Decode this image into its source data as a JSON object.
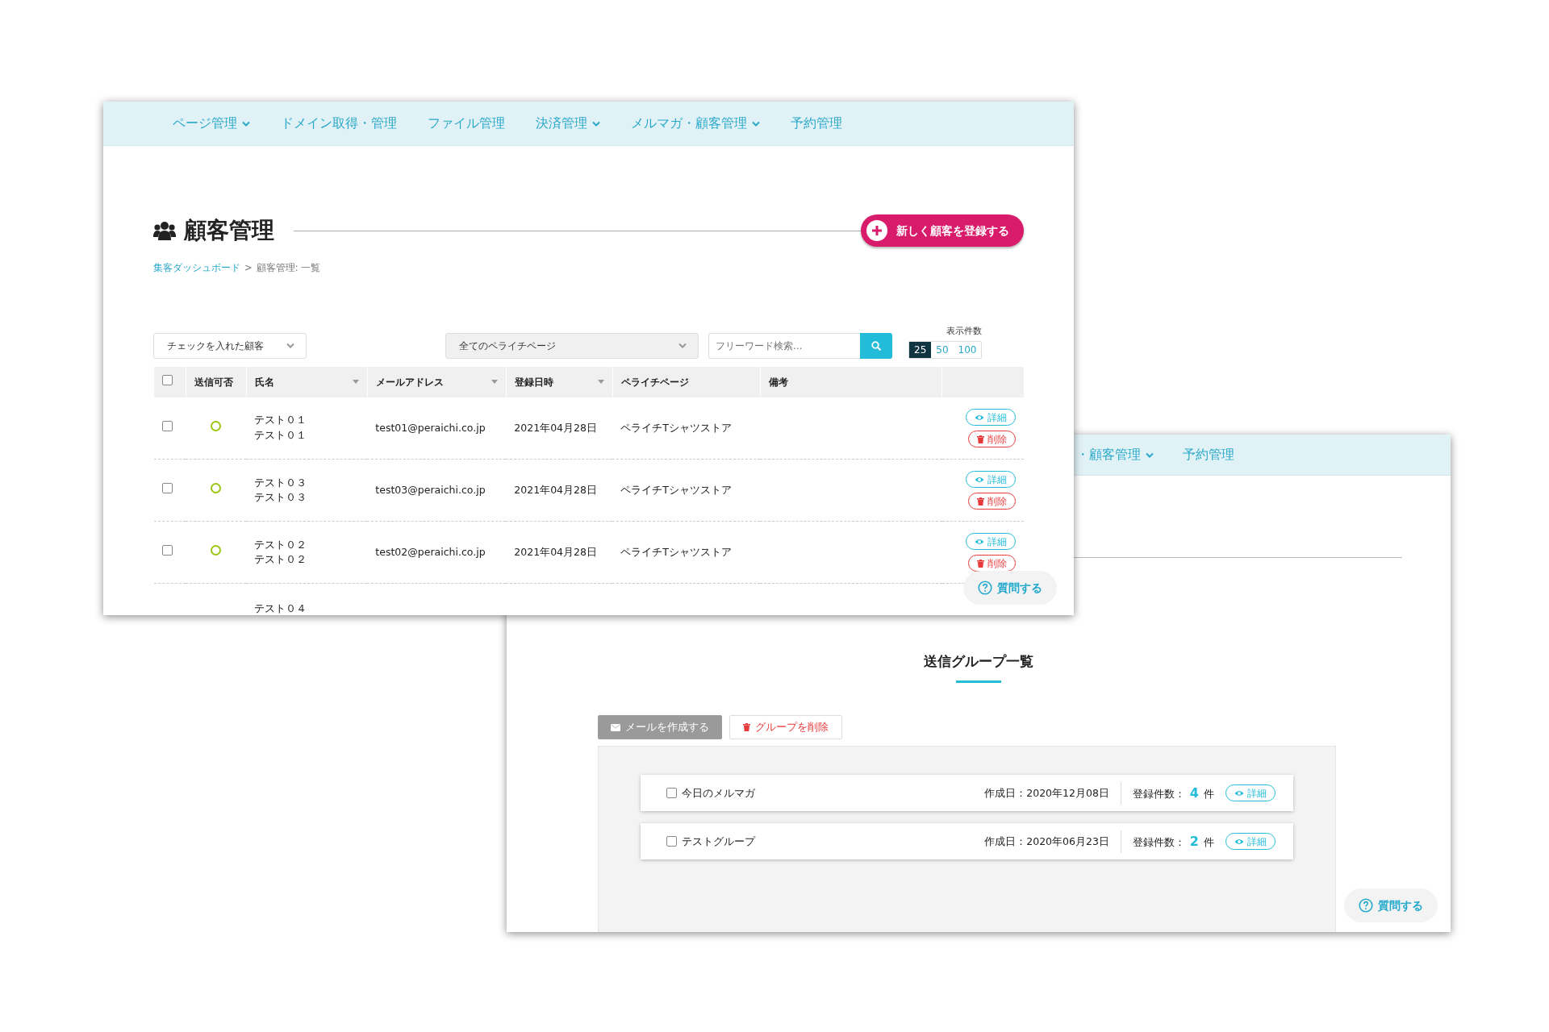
{
  "window_front": {
    "nav": [
      {
        "label": "ページ管理",
        "dropdown": true
      },
      {
        "label": "ドメイン取得・管理",
        "dropdown": false
      },
      {
        "label": "ファイル管理",
        "dropdown": false
      },
      {
        "label": "決済管理",
        "dropdown": true
      },
      {
        "label": "メルマガ・顧客管理",
        "dropdown": true
      },
      {
        "label": "予約管理",
        "dropdown": false
      }
    ],
    "title": "顧客管理",
    "new_button": "新しく顧客を登録する",
    "breadcrumb": {
      "link": "集客ダッシュボード",
      "separator": ">",
      "current": "顧客管理: 一覧"
    },
    "filters": {
      "bulk_select": "チェックを入れた顧客",
      "page_select": "全てのペライチページ",
      "search": {
        "placeholder": "フリーワード検索..."
      }
    },
    "page_size": {
      "label": "表示件数",
      "options": [
        {
          "label": "25",
          "selected": true
        },
        {
          "label": "50",
          "selected": false
        },
        {
          "label": "100",
          "selected": false
        }
      ]
    },
    "table": {
      "header_checked": false,
      "columns": [
        {
          "label": "送信可否",
          "sortable": false
        },
        {
          "label": "氏名",
          "sortable": true
        },
        {
          "label": "メールアドレス",
          "sortable": true
        },
        {
          "label": "登録日時",
          "sortable": true
        },
        {
          "label": "ペライチページ",
          "sortable": false
        },
        {
          "label": "備考",
          "sortable": false
        }
      ],
      "rows": [
        {
          "checked": false,
          "can_send": true,
          "name": [
            "テスト０１",
            "テスト０１"
          ],
          "email": "test01@peraichi.co.jp",
          "date": "2021年04月28日",
          "page": "ペライチTシャツストア",
          "actions": [
            "詳細",
            "削除"
          ]
        },
        {
          "checked": false,
          "can_send": true,
          "name": [
            "テスト０３",
            "テスト０３"
          ],
          "email": "test03@peraichi.co.jp",
          "date": "2021年04月28日",
          "page": "ペライチTシャツストア",
          "actions": [
            "詳細",
            "削除"
          ]
        },
        {
          "checked": false,
          "can_send": true,
          "name": [
            "テスト０２",
            "テスト０２"
          ],
          "email": "test02@peraichi.co.jp",
          "date": "2021年04月28日",
          "page": "ペライチTシャツストア",
          "actions": [
            "詳細",
            "削除"
          ]
        },
        {
          "name": [
            "テスト０４"
          ]
        }
      ]
    },
    "help_button": "質問する"
  },
  "window_back": {
    "nav": [
      {
        "label": "・顧客管理",
        "dropdown": true
      },
      {
        "label": "予約管理",
        "dropdown": false
      }
    ],
    "section_title": "送信グループ一覧",
    "buttons": [
      {
        "label": "メールを作成する",
        "kind": "mail",
        "disabled": true
      },
      {
        "label": "グループを削除",
        "kind": "delete",
        "disabled": false
      }
    ],
    "groups": [
      {
        "checked": false,
        "name": "今日のメルマガ",
        "created": "作成日：2020年12月08日",
        "count_label": "登録件数：",
        "count": "4",
        "unit": "件",
        "action": "詳細"
      },
      {
        "checked": false,
        "name": "テストグループ",
        "created": "作成日：2020年06月23日",
        "count_label": "登録件数：",
        "count": "2",
        "unit": "件",
        "action": "詳細"
      }
    ],
    "help_button": "質問する"
  }
}
